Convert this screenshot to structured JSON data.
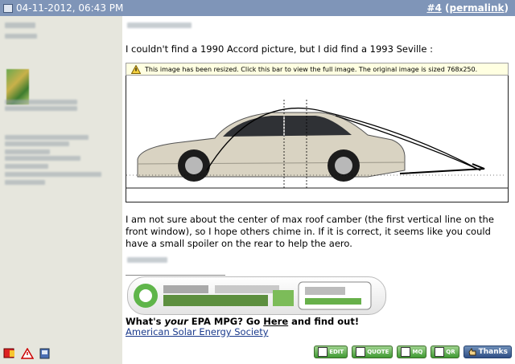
{
  "post": {
    "date": "04-11-2012, 06:43 PM",
    "number": "#4",
    "permalink_label": "permalink",
    "intro": "I couldn't find a 1990 Accord picture, but I did find a 1993 Seville :",
    "resize_notice": "This image has been resized. Click this bar to view the full image. The original image is sized 768x250.",
    "body": "I am not sure about the center of max roof camber (the first vertical line on the front window), so I hope others chime in. If it is correct, it seems like you could have a small spoiler on the rear to help the aero."
  },
  "signature": {
    "question_parts": [
      "What's ",
      "your",
      " EPA MPG? Go ",
      "Here",
      " and find out!"
    ],
    "link": "American Solar Energy Society"
  },
  "buttons": [
    "EDIT",
    "QUOTE",
    "MQ",
    "QR",
    "Thanks"
  ],
  "icons": [
    "post-icon",
    "warning-icon",
    "report-icon",
    "alert-icon",
    "profile-icon",
    "thanks-icon"
  ]
}
